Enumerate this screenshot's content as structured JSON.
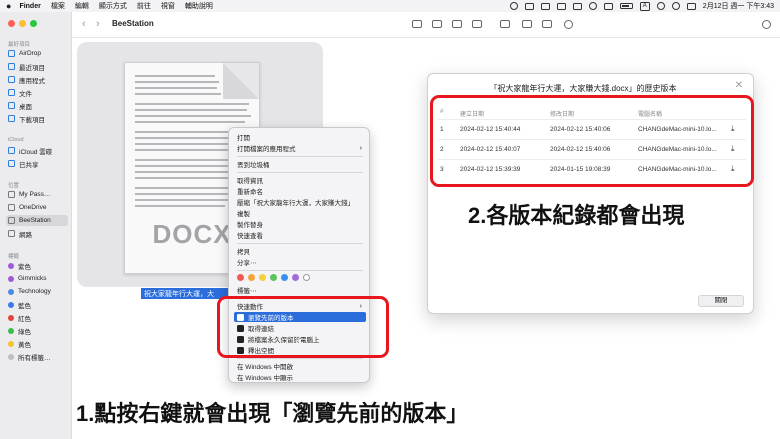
{
  "menubar": {
    "app": "Finder",
    "items": [
      "檔案",
      "編輯",
      "顯示方式",
      "前往",
      "視窗",
      "輔助說明"
    ],
    "input_method": "A",
    "clock": "2月12日 週一 下午3:43"
  },
  "window": {
    "folder_title": "BeeStation"
  },
  "sidebar": {
    "favorites_heading": "最好項目",
    "favorites": [
      "AirDrop",
      "最近項目",
      "應用程式",
      "文件",
      "桌面",
      "下載項目"
    ],
    "icloud_heading": "iCloud",
    "icloud": [
      "iCloud 雲碟",
      "已共享"
    ],
    "locations_heading": "位置",
    "locations": [
      "My Pass…",
      "OneDrive",
      "BeeStation",
      "網路"
    ],
    "tags_heading": "標籤",
    "tags": [
      {
        "label": "紫色",
        "color": "#a05bd6"
      },
      {
        "label": "Gimmicks",
        "color": "#a05bd6"
      },
      {
        "label": "Technology",
        "color": "#4a8be0"
      },
      {
        "label": "藍色",
        "color": "#3b7be8"
      },
      {
        "label": "紅色",
        "color": "#e0443c"
      },
      {
        "label": "綠色",
        "color": "#3dbb4e"
      },
      {
        "label": "黃色",
        "color": "#f0c233"
      },
      {
        "label": "所有標籤…",
        "color": "#bdbdc2"
      }
    ]
  },
  "file": {
    "extension": "DOCX",
    "name": "祝大家龍年行大運，大"
  },
  "context_menu": {
    "open": "打開",
    "open_with": "打開檔案的應用程式",
    "trash": "丟到垃圾桶",
    "get_info": "取得資訊",
    "rename": "重新命名",
    "compress": "壓縮「祝大家龍年行大運，大家賺大錢」",
    "duplicate": "複製",
    "make_alias": "製作替身",
    "quick_look": "快速查看",
    "copy": "拷貝",
    "share": "分享⋯",
    "tag_colors": [
      "#ee5a52",
      "#f4a23a",
      "#f3d13c",
      "#5ac35a",
      "#3b8ff0",
      "#a46ad9",
      "#ffffff"
    ],
    "tags": "標籤⋯",
    "quick_actions": "快速動作",
    "browse_versions": "瀏覽先前的版本",
    "get_link": "取得連結",
    "keep_on_device": "將檔案永久保留於電腦上",
    "free_space": "釋出空間",
    "windows_open": "在 Windows 中開啟",
    "windows_show": "在 Windows 中顯示"
  },
  "history_dialog": {
    "title": "「祝大家龍年行大運，大家賺大錢.docx」的歷史版本",
    "columns": [
      "#",
      "建立日期",
      "修改日期",
      "電腦名稱"
    ],
    "rows": [
      {
        "n": "1",
        "created": "2024-02-12 15:40:44",
        "modified": "2024-02-12 15:40:06",
        "computer": "CHANGdeMac-mini-10.lo..."
      },
      {
        "n": "2",
        "created": "2024-02-12 15:40:07",
        "modified": "2024-02-12 15:40:06",
        "computer": "CHANGdeMac-mini-10.lo..."
      },
      {
        "n": "3",
        "created": "2024-02-12 15:39:39",
        "modified": "2024-01-15 19:08:39",
        "computer": "CHANGdeMac-mini-10.lo..."
      }
    ],
    "close_button": "關閉",
    "close_glyph": "✕"
  },
  "annotations": {
    "step1": "1.點按右鍵就會出現「瀏覽先前的版本」",
    "step2": "2.各版本紀錄都會出現",
    "highlight_color": "#e8161e"
  }
}
